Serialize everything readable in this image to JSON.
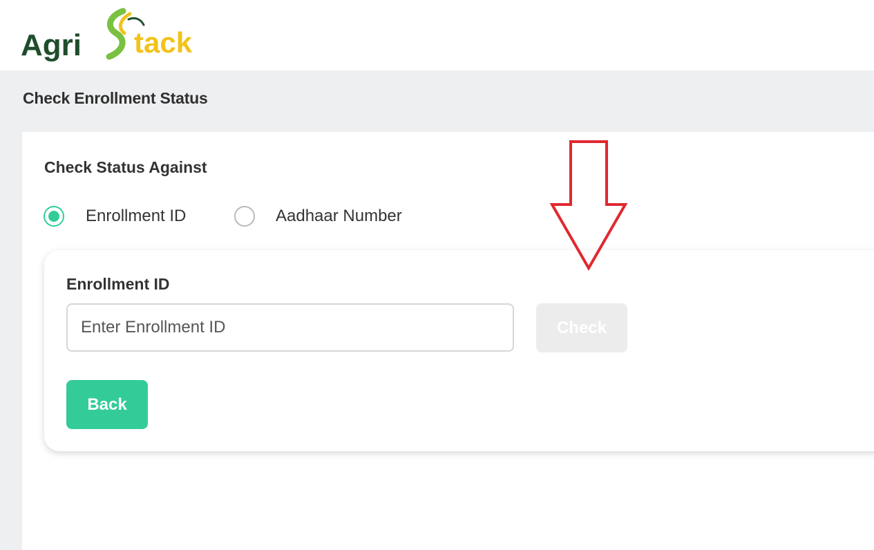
{
  "brand": {
    "logo_part1": "Agri",
    "logo_part2": "Stack",
    "logo_dark_color": "#1f4d2c",
    "logo_green_color": "#7ac142",
    "logo_yellow_color": "#f2c21b"
  },
  "page": {
    "title": "Check Enrollment Status"
  },
  "status_form": {
    "section_title": "Check Status Against",
    "options": [
      {
        "label": "Enrollment ID",
        "selected": true
      },
      {
        "label": "Aadhaar Number",
        "selected": false
      }
    ],
    "field_label": "Enrollment ID",
    "input_value": "",
    "input_placeholder": "Enter Enrollment ID",
    "check_label": "Check",
    "check_disabled": true,
    "back_label": "Back"
  },
  "colors": {
    "accent": "#33cc99",
    "disabled_button": "#ececec",
    "page_background": "#eeeff1",
    "annotation_arrow": "#e0282f"
  },
  "annotation": {
    "icon": "red-down-arrow-icon"
  }
}
